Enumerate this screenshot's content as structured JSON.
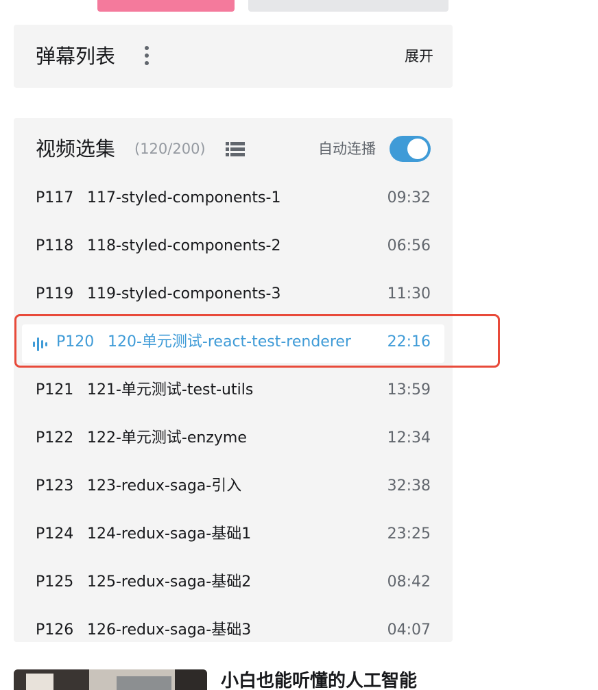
{
  "danmaku": {
    "title": "弹幕列表",
    "expand_label": "展开"
  },
  "episodes_panel": {
    "title": "视频选集",
    "count": "(120/200)",
    "autoplay_label": "自动连播",
    "autoplay_on": true,
    "accent_color": "#3f9bd7",
    "items": [
      {
        "code": "P117",
        "name": "117-styled-components-1",
        "duration": "09:32",
        "active": false
      },
      {
        "code": "P118",
        "name": "118-styled-components-2",
        "duration": "06:56",
        "active": false
      },
      {
        "code": "P119",
        "name": "119-styled-components-3",
        "duration": "11:30",
        "active": false
      },
      {
        "code": "P120",
        "name": "120-单元测试-react-test-renderer",
        "duration": "22:16",
        "active": true
      },
      {
        "code": "P121",
        "name": "121-单元测试-test-utils",
        "duration": "13:59",
        "active": false
      },
      {
        "code": "P122",
        "name": "122-单元测试-enzyme",
        "duration": "12:34",
        "active": false
      },
      {
        "code": "P123",
        "name": "123-redux-saga-引入",
        "duration": "32:38",
        "active": false
      },
      {
        "code": "P124",
        "name": "124-redux-saga-基础1",
        "duration": "23:25",
        "active": false
      },
      {
        "code": "P125",
        "name": "125-redux-saga-基础2",
        "duration": "08:42",
        "active": false
      },
      {
        "code": "P126",
        "name": "126-redux-saga-基础3",
        "duration": "04:07",
        "active": false
      }
    ]
  },
  "recommendation": {
    "title": "小白也能听懂的人工智能"
  },
  "icons": {
    "more": "more-vertical-icon",
    "list": "list-view-icon",
    "playing": "playing-wave-icon"
  },
  "colors": {
    "highlight": "#e84a3a",
    "pink_button": "#f47a9c"
  }
}
